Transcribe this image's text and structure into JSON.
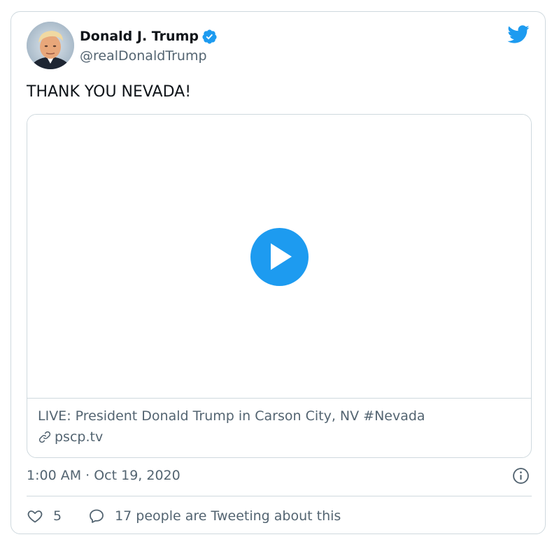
{
  "author": {
    "name": "Donald J. Trump",
    "handle": "@realDonaldTrump",
    "verified": true
  },
  "tweet": {
    "text": "THANK YOU NEVADA!",
    "timestamp": "1:00 AM · Oct 19, 2020"
  },
  "media_card": {
    "title": "LIVE: President Donald Trump in Carson City, NV #Nevada",
    "domain": "pscp.tv"
  },
  "actions": {
    "likes": "5",
    "conversation": "17 people are Tweeting about this"
  },
  "icons": {
    "brand": "twitter-logo-icon",
    "verified": "verified-badge-icon",
    "play": "play-icon",
    "link": "link-icon",
    "info": "info-icon",
    "like": "heart-icon",
    "reply": "comment-icon"
  },
  "colors": {
    "accent": "#1d9bf0",
    "text_primary": "#0f1419",
    "text_secondary": "#536471",
    "border": "#cfd9de"
  }
}
